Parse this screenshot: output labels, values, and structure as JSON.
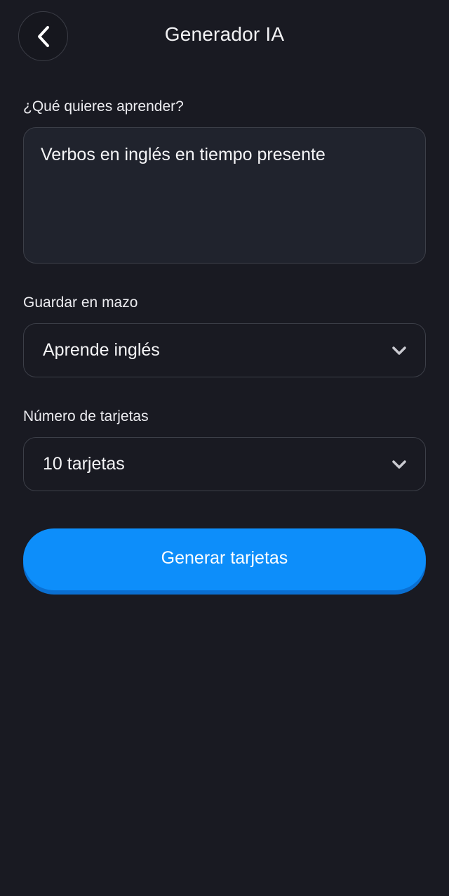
{
  "header": {
    "title": "Generador IA",
    "back_icon": "chevron-left-icon"
  },
  "topic": {
    "label": "¿Qué quieres aprender?",
    "value": "Verbos en inglés en tiempo presente"
  },
  "deck": {
    "label": "Guardar en mazo",
    "selected": "Aprende inglés",
    "icon": "chevron-down-icon"
  },
  "cards": {
    "label": "Número de tarjetas",
    "selected": "10 tarjetas",
    "icon": "chevron-down-icon"
  },
  "actions": {
    "generate_label": "Generar tarjetas"
  },
  "colors": {
    "background": "#191a22",
    "field_background": "#20232d",
    "border": "#3c3f48",
    "accent": "#0d8efa",
    "accent_shadow": "#0a6fd1"
  }
}
